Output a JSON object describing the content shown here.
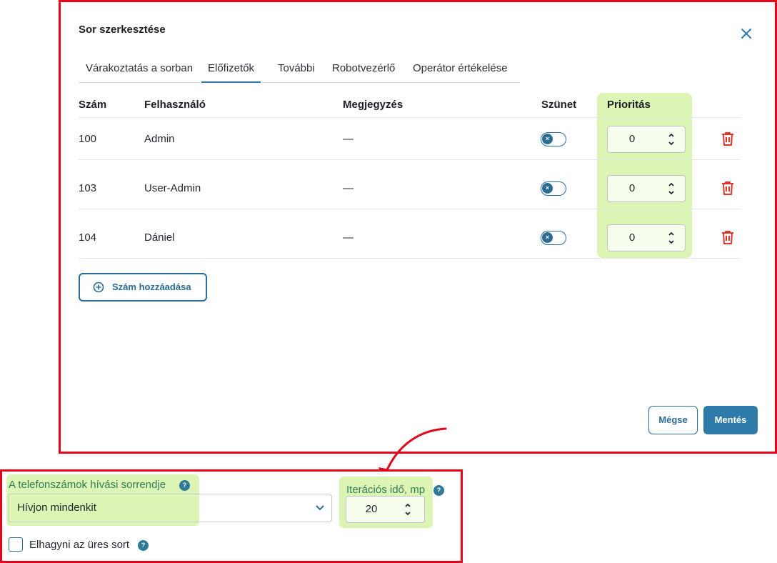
{
  "colors": {
    "accent": "#2b6c93",
    "annotation_border": "#e3061b",
    "highlight": "#dcf5b4",
    "delete": "#e0362c",
    "label_green": "#2f7d5a"
  },
  "dialog": {
    "title": "Sor szerkesztése",
    "close_icon": "close-icon",
    "tabs": [
      {
        "label": "Várakoztatás a sorban",
        "active": false
      },
      {
        "label": "Előfizetők",
        "active": true
      },
      {
        "label": "További",
        "active": false
      },
      {
        "label": "Robotvezérlő",
        "active": false
      },
      {
        "label": "Operátor értékelése",
        "active": false
      }
    ],
    "table": {
      "headers": {
        "number": "Szám",
        "user": "Felhasználó",
        "note": "Megjegyzés",
        "pause": "Szünet",
        "priority": "Prioritás"
      },
      "rows": [
        {
          "number": "100",
          "user": "Admin",
          "note": "—",
          "pause": false,
          "priority": "0"
        },
        {
          "number": "103",
          "user": "User-Admin",
          "note": "—",
          "pause": false,
          "priority": "0"
        },
        {
          "number": "104",
          "user": "Dániel",
          "note": "—",
          "pause": false,
          "priority": "0"
        }
      ]
    },
    "add_button": "Szám hozzáadása",
    "cancel_button": "Mégse",
    "save_button": "Mentés"
  },
  "settings": {
    "call_order_label": "A telefonszámok hívási sorrendje",
    "call_order_value": "Hívjon mindenkit",
    "iteration_label": "Iterációs idő, mp",
    "iteration_value": "20",
    "skip_empty_label": "Elhagyni az üres sort",
    "skip_empty_checked": false,
    "help_glyph": "?"
  }
}
